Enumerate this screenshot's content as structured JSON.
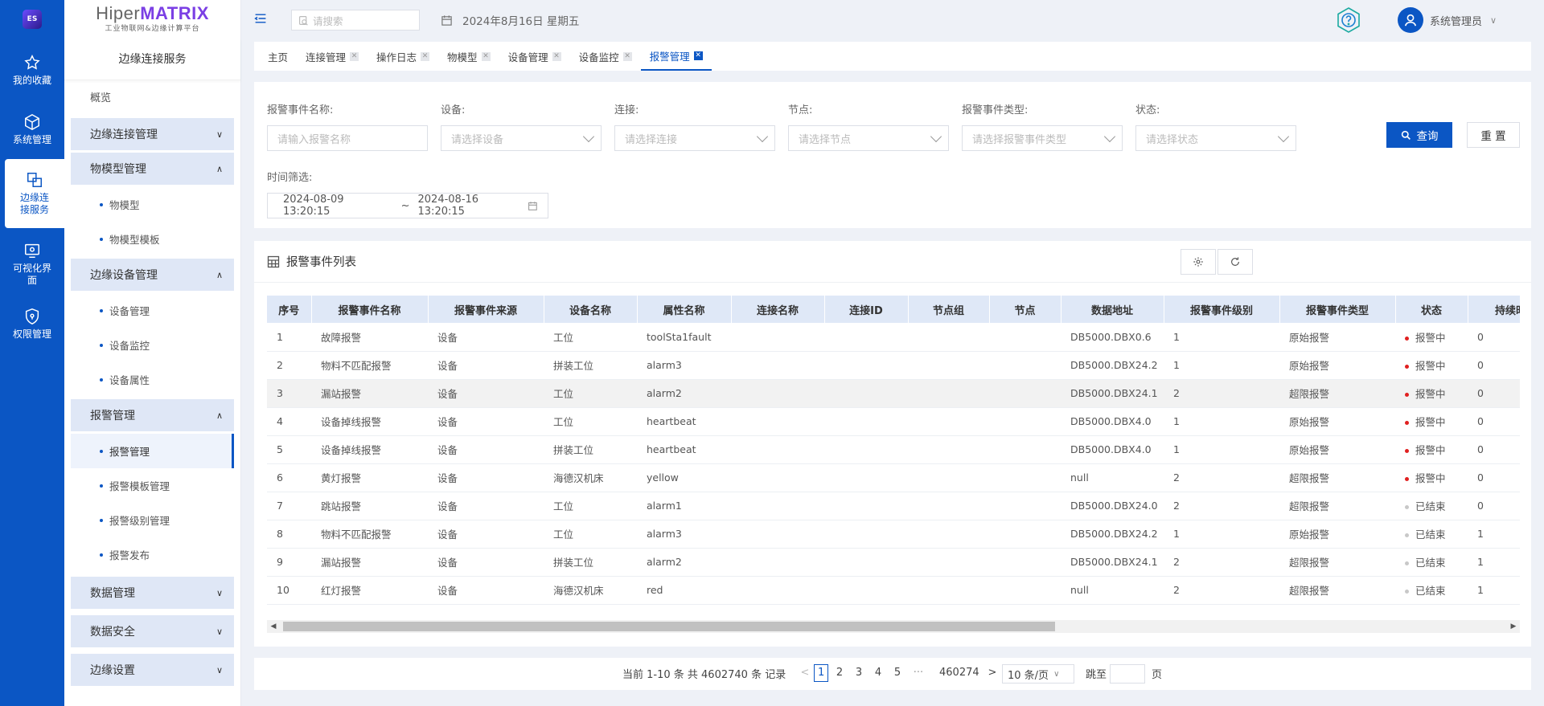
{
  "rail": {
    "logo": "ES",
    "items": [
      {
        "label": "我的收藏",
        "icon": "star-icon"
      },
      {
        "label": "系统管理",
        "icon": "cube-icon"
      },
      {
        "label": "边缘连接服务",
        "icon": "connect-icon"
      },
      {
        "label": "可视化界面",
        "icon": "monitor-icon"
      },
      {
        "label": "权限管理",
        "icon": "shield-icon"
      }
    ]
  },
  "brand": {
    "name_plain": "Hiper",
    "name_bold": "MATRIX",
    "subtitle": "工业物联网&边缘计算平台"
  },
  "sidebar": {
    "title": "边缘连接服务",
    "overview": "概览",
    "groups": {
      "edge_conn": "边缘连接管理",
      "model": "物模型管理",
      "model_items": [
        "物模型",
        "物模型模板"
      ],
      "device": "边缘设备管理",
      "device_items": [
        "设备管理",
        "设备监控",
        "设备属性"
      ],
      "alarm": "报警管理",
      "alarm_items": [
        "报警管理",
        "报警模板管理",
        "报警级别管理",
        "报警发布"
      ],
      "data": "数据管理",
      "security": "数据安全",
      "settings": "边缘设置"
    }
  },
  "topbar": {
    "search_placeholder": "请搜索",
    "date": "2024年8月16日 星期五",
    "user": "系统管理员"
  },
  "tabs": [
    "主页",
    "连接管理",
    "操作日志",
    "物模型",
    "设备管理",
    "设备监控",
    "报警管理"
  ],
  "filter": {
    "name_label": "报警事件名称:",
    "name_placeholder": "请输入报警名称",
    "device_label": "设备:",
    "device_placeholder": "请选择设备",
    "conn_label": "连接:",
    "conn_placeholder": "请选择连接",
    "node_label": "节点:",
    "node_placeholder": "请选择节点",
    "type_label": "报警事件类型:",
    "type_placeholder": "请选择报警事件类型",
    "status_label": "状态:",
    "status_placeholder": "请选择状态",
    "time_label": "时间筛选:",
    "time_start": "2024-08-09 13:20:15",
    "time_sep": "~",
    "time_end": "2024-08-16 13:20:15",
    "query": "查询",
    "reset": "重 置"
  },
  "table": {
    "title": "报警事件列表",
    "columns": [
      "序号",
      "报警事件名称",
      "报警事件来源",
      "设备名称",
      "属性名称",
      "连接名称",
      "连接ID",
      "节点组",
      "节点",
      "数据地址",
      "报警事件级别",
      "报警事件类型",
      "状态",
      "持续时"
    ],
    "rows": [
      {
        "no": "1",
        "name": "故障报警",
        "source": "设备",
        "device": "工位",
        "prop": "toolSta1fault",
        "addr": "DB5000.DBX0.6",
        "level": "1",
        "type": "原始报警",
        "status": "报警中",
        "dur": "0"
      },
      {
        "no": "2",
        "name": "物料不匹配报警",
        "source": "设备",
        "device": "拼装工位",
        "prop": "alarm3",
        "addr": "DB5000.DBX24.2",
        "level": "1",
        "type": "原始报警",
        "status": "报警中",
        "dur": "0"
      },
      {
        "no": "3",
        "name": "漏站报警",
        "source": "设备",
        "device": "工位",
        "prop": "alarm2",
        "addr": "DB5000.DBX24.1",
        "level": "2",
        "type": "超限报警",
        "status": "报警中",
        "dur": "0"
      },
      {
        "no": "4",
        "name": "设备掉线报警",
        "source": "设备",
        "device": "工位",
        "prop": "heartbeat",
        "addr": "DB5000.DBX4.0",
        "level": "1",
        "type": "原始报警",
        "status": "报警中",
        "dur": "0"
      },
      {
        "no": "5",
        "name": "设备掉线报警",
        "source": "设备",
        "device": "拼装工位",
        "prop": "heartbeat",
        "addr": "DB5000.DBX4.0",
        "level": "1",
        "type": "原始报警",
        "status": "报警中",
        "dur": "0"
      },
      {
        "no": "6",
        "name": "黄灯报警",
        "source": "设备",
        "device": "海德汉机床",
        "prop": "yellow",
        "addr": "null",
        "level": "2",
        "type": "超限报警",
        "status": "报警中",
        "dur": "0"
      },
      {
        "no": "7",
        "name": "跳站报警",
        "source": "设备",
        "device": "工位",
        "prop": "alarm1",
        "addr": "DB5000.DBX24.0",
        "level": "2",
        "type": "超限报警",
        "status": "已结束",
        "dur": "0"
      },
      {
        "no": "8",
        "name": "物料不匹配报警",
        "source": "设备",
        "device": "工位",
        "prop": "alarm3",
        "addr": "DB5000.DBX24.2",
        "level": "1",
        "type": "原始报警",
        "status": "已结束",
        "dur": "1"
      },
      {
        "no": "9",
        "name": "漏站报警",
        "source": "设备",
        "device": "拼装工位",
        "prop": "alarm2",
        "addr": "DB5000.DBX24.1",
        "level": "2",
        "type": "超限报警",
        "status": "已结束",
        "dur": "1"
      },
      {
        "no": "10",
        "name": "红灯报警",
        "source": "设备",
        "device": "海德汉机床",
        "prop": "red",
        "addr": "null",
        "level": "2",
        "type": "超限报警",
        "status": "已结束",
        "dur": "1"
      }
    ],
    "status_colors": {
      "报警中": "#e02020",
      "已结束": "#c8c8c8"
    }
  },
  "pager": {
    "summary": "当前 1-10 条 共 4602740 条 记录",
    "pages": [
      "1",
      "2",
      "3",
      "4",
      "5"
    ],
    "ellipsis": "···",
    "last": "460274",
    "size": "10 条/页",
    "jump_label": "跳至",
    "page_suffix": "页"
  },
  "colors": {
    "primary": "#0b56c4",
    "brand_accent": "#7b3fe4",
    "header_row": "#dfe8f7"
  }
}
